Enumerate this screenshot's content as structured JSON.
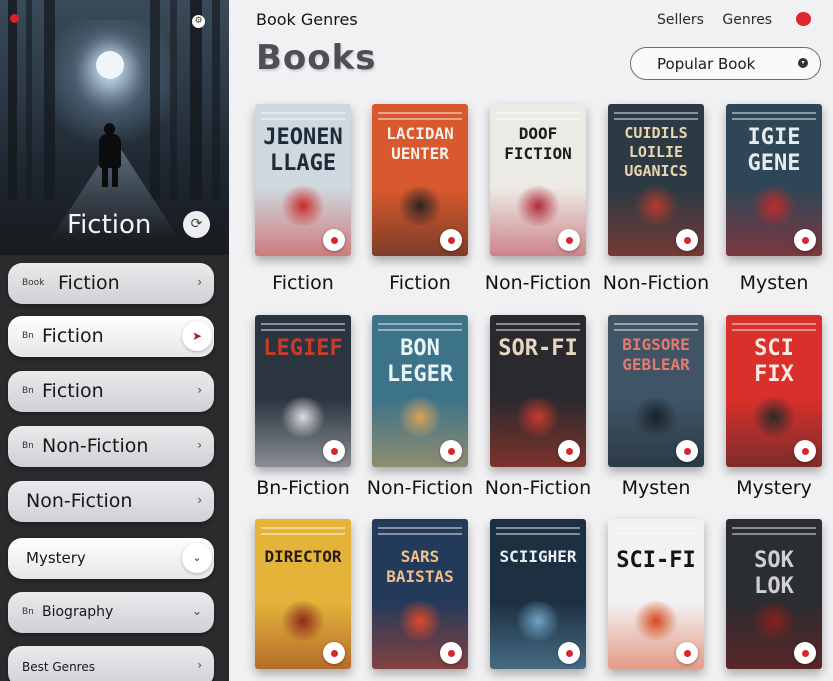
{
  "sidebar": {
    "featured_title": "Fiction",
    "items": [
      {
        "prefix": "Book",
        "label": "Fiction",
        "control": "chevron"
      },
      {
        "prefix": "Bn",
        "label": "Fiction",
        "control": "circle"
      },
      {
        "prefix": "Bn",
        "label": "Fiction",
        "control": "chevron"
      },
      {
        "prefix": "Bn",
        "label": "Non-Fiction",
        "control": "chevron"
      },
      {
        "prefix": "",
        "label": "Non-Fiction",
        "control": "chevron"
      },
      {
        "prefix": "",
        "label": "Mystery",
        "control": "chevron"
      },
      {
        "prefix": "Bn",
        "label": "Biography",
        "control": "chevron"
      },
      {
        "prefix": "",
        "label": "Best Genres",
        "control": "chevron"
      }
    ]
  },
  "header": {
    "title": "Book Genres",
    "links": [
      "Sellers",
      "Genres"
    ],
    "big_title": "Books",
    "popular_button": "Popular Book"
  },
  "books": [
    {
      "title_lines": [
        "JEONEN",
        "LLAGE"
      ],
      "genre": "Fiction",
      "bg": "#cfd8de",
      "fg": "#1d2a38",
      "accent": "#c92a2a"
    },
    {
      "title_lines": [
        "LACIDAN",
        "UENTER"
      ],
      "genre": "Fiction",
      "bg": "#d9592e",
      "fg": "#f3efe8",
      "accent": "#2b2424"
    },
    {
      "title_lines": [
        "DOOF",
        "FICTION"
      ],
      "genre": "Non-Fiction",
      "bg": "#eceae4",
      "fg": "#1c1c1c",
      "accent": "#b12a3a"
    },
    {
      "title_lines": [
        "CUIDILS",
        "LOILIE",
        "UGANICS"
      ],
      "genre": "Non-Fiction",
      "bg": "#2d3a44",
      "fg": "#e8d6b0",
      "accent": "#b23b2b"
    },
    {
      "title_lines": [
        "IGIE",
        "GENE"
      ],
      "genre": "Mysten",
      "bg": "#2f4656",
      "fg": "#e4ecf0",
      "accent": "#c02b2b"
    },
    {
      "title_lines": [
        "LEGIEF"
      ],
      "genre": "Bn-Fiction",
      "bg": "#2a3540",
      "fg": "#c83a2a",
      "accent": "#dddddd"
    },
    {
      "title_lines": [
        "BON",
        "LEGER"
      ],
      "genre": "Non-Fiction",
      "bg": "#3c7388",
      "fg": "#eaf4f6",
      "accent": "#d9a35b"
    },
    {
      "title_lines": [
        "SOR-FI"
      ],
      "genre": "Non-Fiction",
      "bg": "#2a2a2e",
      "fg": "#e7d7c0",
      "accent": "#c83a2a"
    },
    {
      "title_lines": [
        "BIGSORE",
        "GEBLEAR"
      ],
      "genre": "Mysten",
      "bg": "#3f5566",
      "fg": "#e47a6f",
      "accent": "#1a2228"
    },
    {
      "title_lines": [
        "SCI",
        "FIX"
      ],
      "genre": "Mystery",
      "bg": "#d9302b",
      "fg": "#fbe8e2",
      "accent": "#2a2a2a"
    },
    {
      "title_lines": [
        "DIRECTOR"
      ],
      "genre": "",
      "bg": "#e3b33a",
      "fg": "#2a1a12",
      "accent": "#8a2a1a"
    },
    {
      "title_lines": [
        "SARS",
        "BAISTAS"
      ],
      "genre": "",
      "bg": "#243a5a",
      "fg": "#f1c08a",
      "accent": "#e0492a"
    },
    {
      "title_lines": [
        "SCIIGHER"
      ],
      "genre": "",
      "bg": "#1d3042",
      "fg": "#e8eef2",
      "accent": "#6fa4c4"
    },
    {
      "title_lines": [
        "SCI-FI"
      ],
      "genre": "",
      "bg": "#f2f2f2",
      "fg": "#151515",
      "accent": "#d4491c"
    },
    {
      "title_lines": [
        "SOK",
        "LOK"
      ],
      "genre": "",
      "bg": "#2a2d31",
      "fg": "#d0d0d0",
      "accent": "#8a1f1f"
    }
  ],
  "icons": {
    "brand_dot": "record-dot-icon",
    "header_dot": "notification-dot-icon"
  }
}
